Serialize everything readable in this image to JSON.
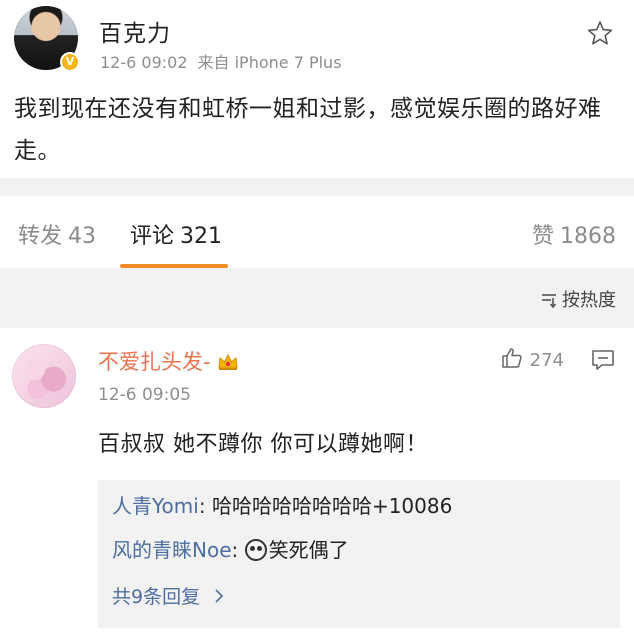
{
  "post": {
    "username": "百克力",
    "timestamp": "12-6 09:02",
    "source": "来自 iPhone 7 Plus",
    "text": "我到现在还没有和虹桥一姐和过影，感觉娱乐圈的路好难走。",
    "verified_icon": "verified-badge-icon"
  },
  "tabs": {
    "repost_label": "转发",
    "repost_count": "43",
    "comment_label": "评论",
    "comment_count": "321",
    "like_label": "赞",
    "like_count": "1868",
    "active": "comment",
    "accent_color": "#f28b2a"
  },
  "sort": {
    "label": "按热度",
    "icon": "sort-icon"
  },
  "comment": {
    "username": "不爱扎头发-",
    "timestamp": "12-6 09:05",
    "like_count": "274",
    "text": "百叔叔 她不蹲你 你可以蹲她啊！",
    "username_color": "#eb7350",
    "badge_icon": "crown-icon",
    "replies": [
      {
        "user": "人青Yomi",
        "sep": ":",
        "text": "哈哈哈哈哈哈哈哈+10086"
      },
      {
        "user": "风的青睐Noe",
        "sep": ":",
        "emoji": "panda-laugh-emoji",
        "text": "笑死偶了"
      }
    ],
    "more_replies": "共9条回复",
    "link_color": "#4e6ea0"
  }
}
